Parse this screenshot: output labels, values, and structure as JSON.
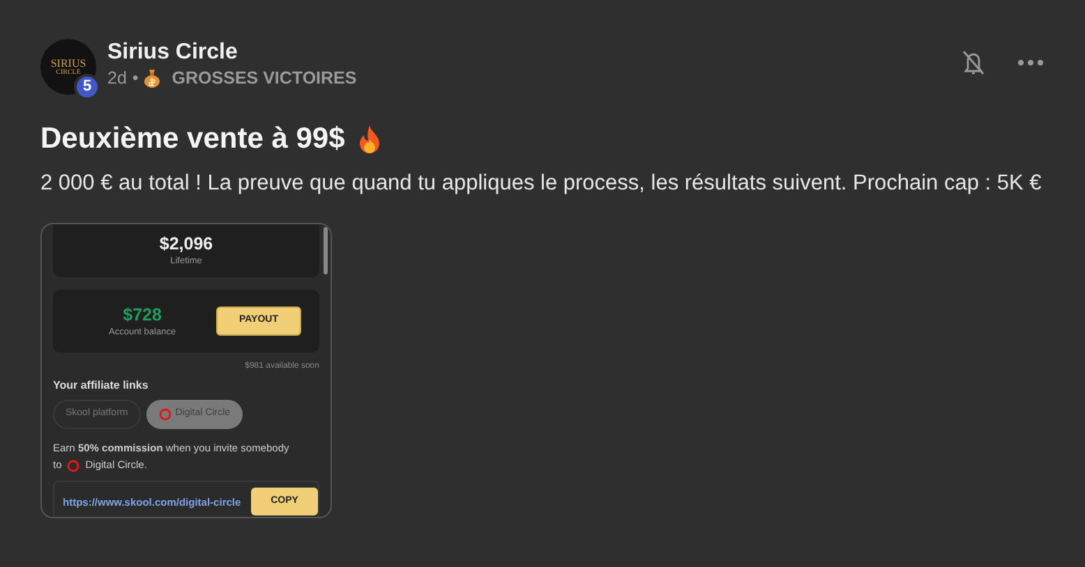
{
  "post": {
    "author": "Sirius Circle",
    "avatar_logo": [
      "SIRIUS",
      "CIRCLE"
    ],
    "level": "5",
    "time": "2d",
    "separator": "•",
    "category": "GROSSES VICTOIRES",
    "title": "Deuxième vente à 99$",
    "body": "2 000 € au total ! La preuve que quand tu appliques le process, les résultats suivent. Prochain cap : 5K €"
  },
  "screenshot": {
    "lifetime": {
      "amount": "$2,096",
      "label": "Lifetime"
    },
    "balance": {
      "amount": "$728",
      "label": "Account balance",
      "button": "PAYOUT"
    },
    "pending": "$981 available soon",
    "heading": "Your affiliate links",
    "tabs": [
      {
        "label": "Skool platform",
        "selected": false,
        "kind": "plain"
      },
      {
        "label": "Digital Circle",
        "selected": true,
        "kind": "ring"
      }
    ],
    "commission_line": "Earn **50% commission** when you invite somebody",
    "commission_to": "to",
    "commission_group": "Digital Circle.",
    "link": "https://www.skool.com/digital-circle",
    "copy_button": "COPY"
  }
}
